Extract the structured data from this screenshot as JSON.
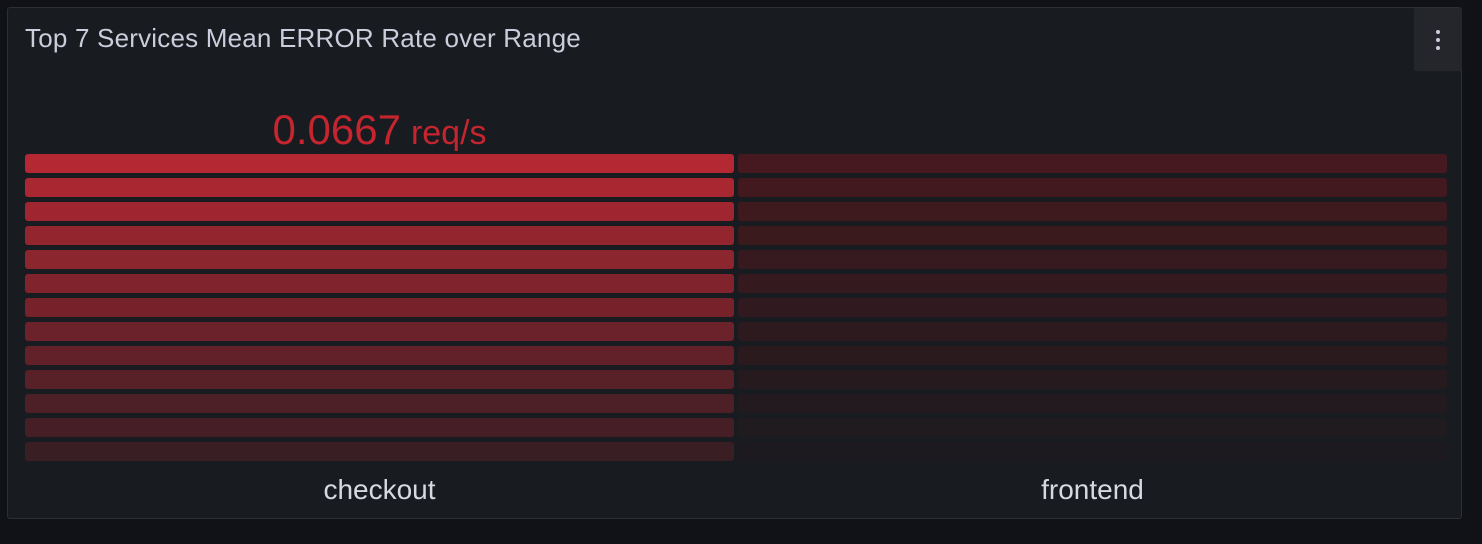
{
  "panel": {
    "title": "Top 7 Services Mean ERROR Rate over Range",
    "menu_icon": "vertical-ellipsis-icon"
  },
  "colors": {
    "accent_red": "#c4252f",
    "bar_lit": "#b32833",
    "bar_unlit": "#45191f",
    "panel_bg": "#181b1f",
    "page_bg": "#111217",
    "title_text": "#ccccdc"
  },
  "chart_data": {
    "type": "bar",
    "title": "Top 7 Services Mean ERROR Rate over Range",
    "unit": "req/s",
    "categories": [
      "checkout",
      "frontend"
    ],
    "values": [
      0.0667,
      0
    ],
    "value_labels": [
      "0.0667",
      ""
    ],
    "display": "retro-lcd bar gauge, vertical",
    "segments_per_bar": 13,
    "max": 0.0667
  }
}
